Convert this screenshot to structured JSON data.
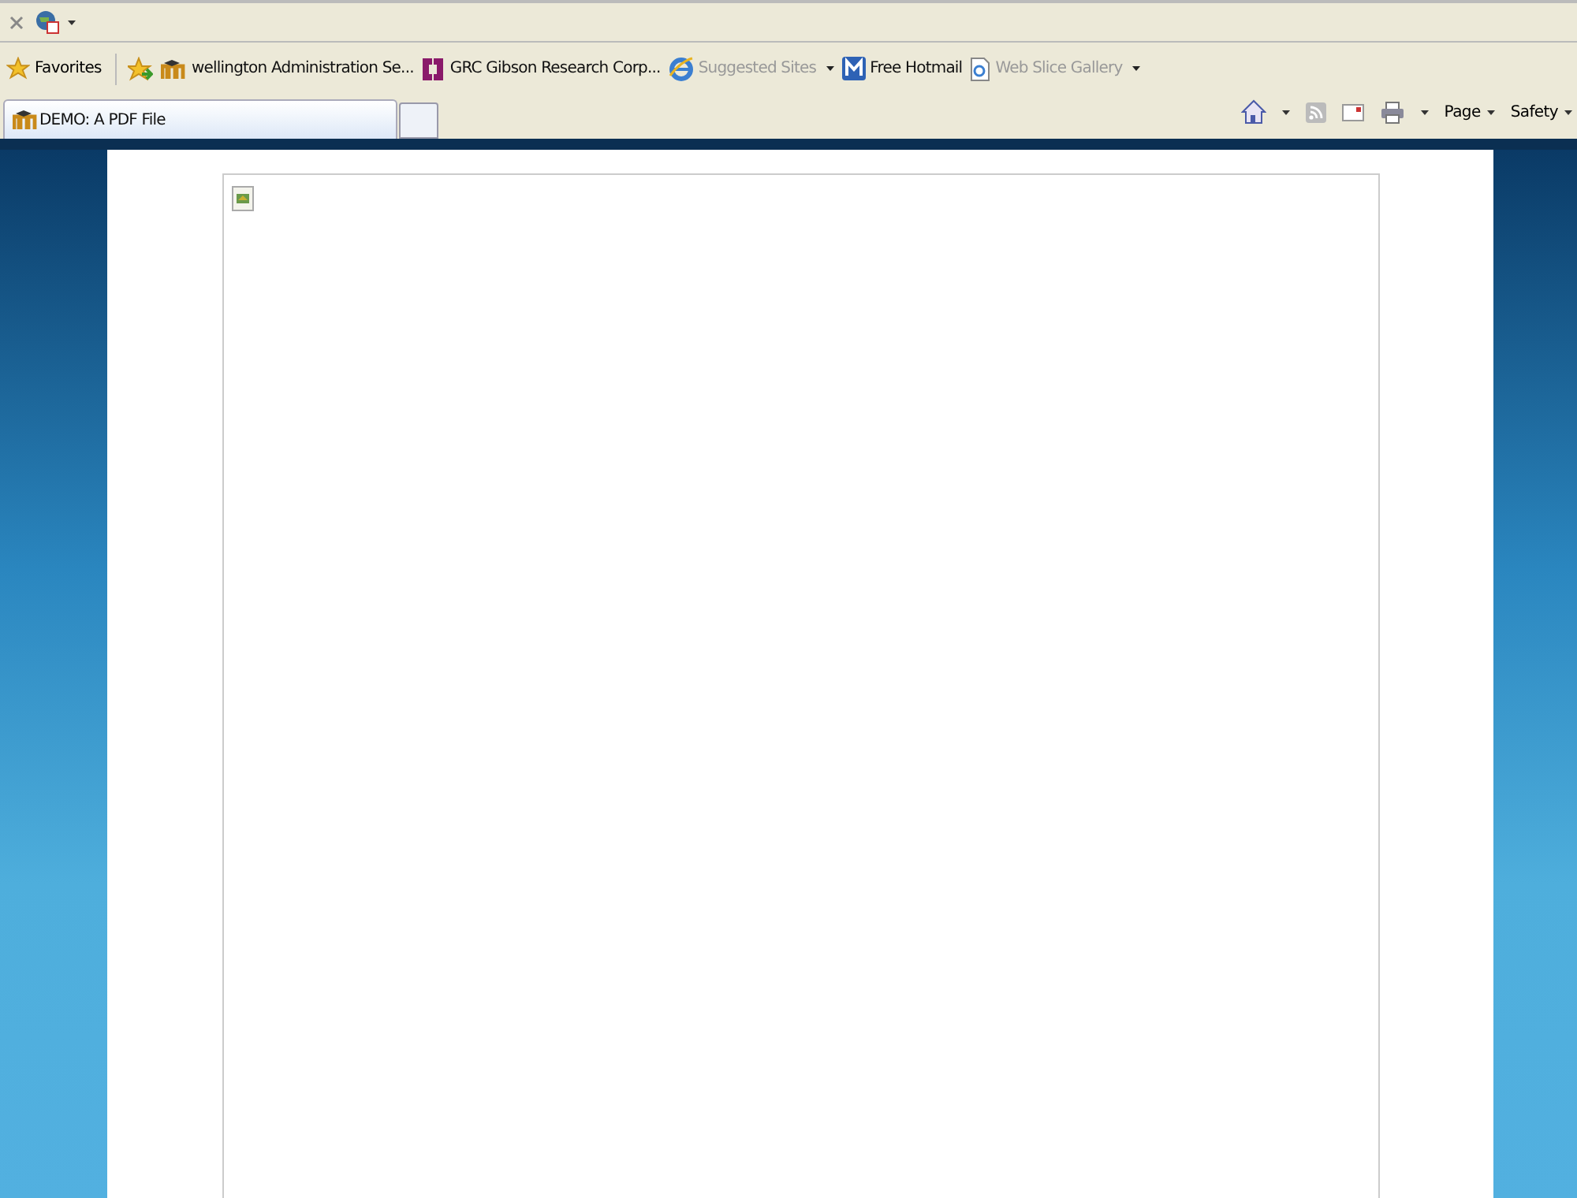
{
  "favorites_bar": {
    "label": "Favorites",
    "items": [
      {
        "label": "wellington Administration Se...",
        "disabled": false,
        "dropdown": false
      },
      {
        "label": "GRC  Gibson Research Corp...",
        "disabled": false,
        "dropdown": false
      },
      {
        "label": "Suggested Sites",
        "disabled": true,
        "dropdown": true
      },
      {
        "label": "Free Hotmail",
        "disabled": false,
        "dropdown": false
      },
      {
        "label": "Web Slice Gallery",
        "disabled": true,
        "dropdown": true
      }
    ]
  },
  "tabs": [
    {
      "label": "DEMO: A PDF File",
      "selected": true
    }
  ],
  "command_bar": {
    "buttons": [
      {
        "label": "Page"
      },
      {
        "label": "Safety"
      }
    ]
  },
  "document": {
    "kind": "broken-image"
  }
}
